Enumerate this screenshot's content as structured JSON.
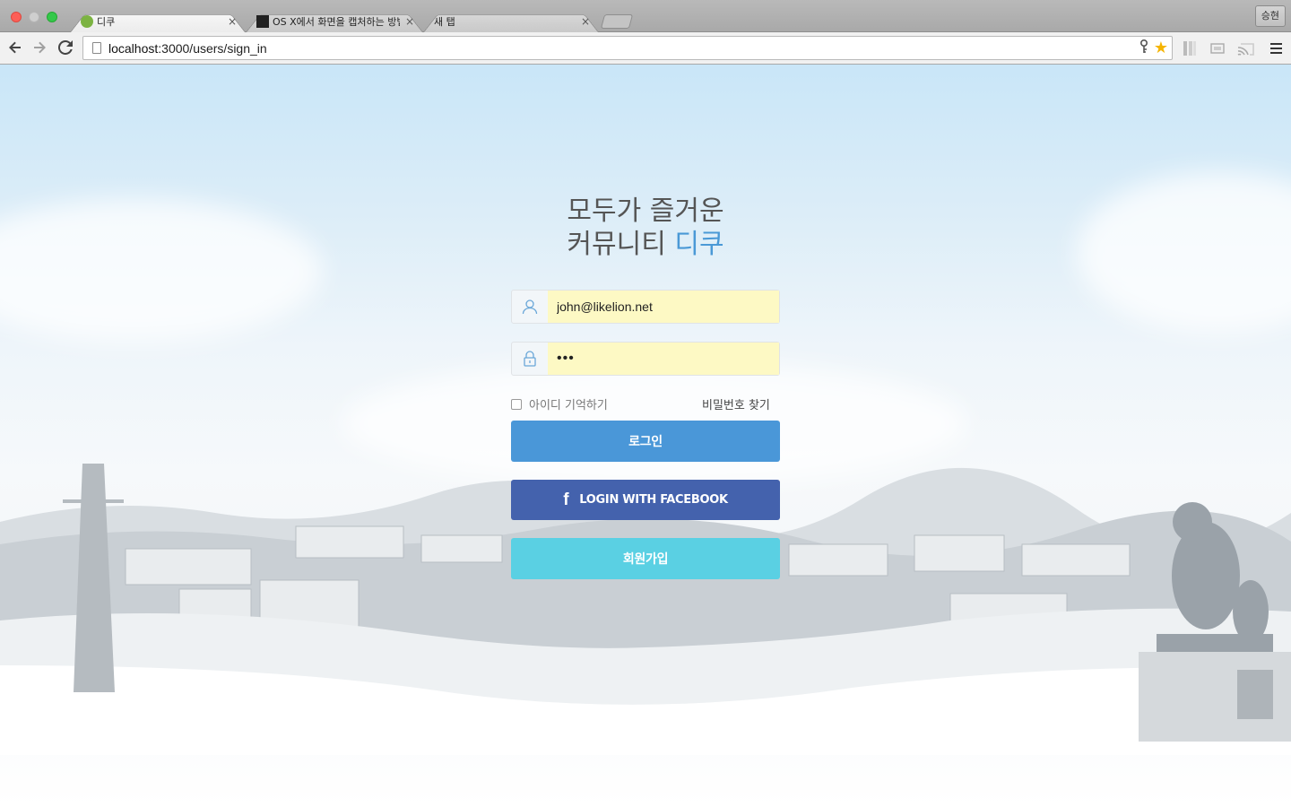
{
  "browser": {
    "tabs": [
      {
        "title": "디쿠",
        "favicon": "likelion-favicon",
        "active": true
      },
      {
        "title": "OS X에서 화면을 캡처하는 방법",
        "favicon": "bzm-favicon",
        "active": false
      },
      {
        "title": "새 탭",
        "favicon": "",
        "active": false
      }
    ],
    "tab_close_glyph": "×",
    "profile_name": "승현",
    "url_host": "localhost",
    "url_rest": ":3000/users/sign_in"
  },
  "login": {
    "heading_line1": "모두가 즐거운",
    "heading_line2_prefix": "커뮤니티 ",
    "heading_brand": "디쿠",
    "email_value": "john@likelion.net",
    "password_value": "•••",
    "remember_label": "아이디 기억하기",
    "find_password_label": "비밀번호 찾기",
    "login_button": "로그인",
    "facebook_button": "LOGIN WITH FACEBOOK",
    "facebook_glyph": "f",
    "signup_button": "회원가입"
  },
  "colors": {
    "brand_blue": "#4a99d6",
    "login_button": "#4a97d8",
    "facebook_button": "#4462ad",
    "signup_button": "#5ad0e3",
    "autofill_yellow": "#fdf9c4"
  },
  "icons": {
    "user": "user-icon",
    "lock": "lock-icon",
    "facebook": "facebook-icon",
    "back": "back-arrow-icon",
    "forward": "forward-arrow-icon",
    "reload": "reload-icon",
    "key": "key-icon",
    "star": "bookmark-star-icon",
    "menu": "menu-icon"
  }
}
